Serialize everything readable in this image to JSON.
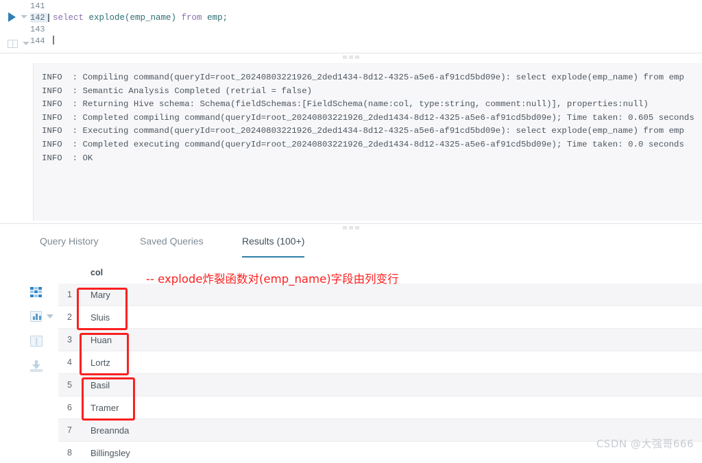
{
  "editor": {
    "gutter_icons": [
      "run-query-icon",
      "run-dropdown-icon",
      "explain-icon",
      "explain-dropdown-icon"
    ],
    "lines": [
      {
        "number": "141",
        "text": "",
        "active": false
      },
      {
        "number": "142",
        "active": true,
        "tokens": [
          {
            "t": "select ",
            "k": "kw"
          },
          {
            "t": "explode(emp_name) ",
            "k": "id"
          },
          {
            "t": "from ",
            "k": "kw"
          },
          {
            "t": "emp;",
            "k": "id"
          }
        ]
      },
      {
        "number": "143",
        "text": "",
        "active": false
      },
      {
        "number": "144",
        "text": "",
        "active": false,
        "cursor": true
      }
    ]
  },
  "log": {
    "lines": [
      "INFO  : Compiling command(queryId=root_20240803221926_2ded1434-8d12-4325-a5e6-af91cd5bd09e): select explode(emp_name) from emp",
      "INFO  : Semantic Analysis Completed (retrial = false)",
      "INFO  : Returning Hive schema: Schema(fieldSchemas:[FieldSchema(name:col, type:string, comment:null)], properties:null)",
      "INFO  : Completed compiling command(queryId=root_20240803221926_2ded1434-8d12-4325-a5e6-af91cd5bd09e); Time taken: 0.605 seconds",
      "INFO  : Executing command(queryId=root_20240803221926_2ded1434-8d12-4325-a5e6-af91cd5bd09e): select explode(emp_name) from emp",
      "INFO  : Completed executing command(queryId=root_20240803221926_2ded1434-8d12-4325-a5e6-af91cd5bd09e); Time taken: 0.0 seconds",
      "INFO  : OK"
    ]
  },
  "tabs": [
    {
      "label": "Query History",
      "active": false
    },
    {
      "label": "Saved Queries",
      "active": false
    },
    {
      "label": "Results (100+)",
      "active": true
    }
  ],
  "sidetools": [
    {
      "name": "grid-view-icon",
      "active": true
    },
    {
      "name": "chart-view-icon",
      "active": false
    },
    {
      "name": "columns-view-icon",
      "active": false
    },
    {
      "name": "download-icon",
      "active": false
    }
  ],
  "results": {
    "column_header": "col",
    "annotation": "-- explode炸裂函数对(emp_name)字段由列变行",
    "rows": [
      {
        "index": "1",
        "col": "Mary"
      },
      {
        "index": "2",
        "col": "Sluis"
      },
      {
        "index": "3",
        "col": "Huan"
      },
      {
        "index": "4",
        "col": "Lortz"
      },
      {
        "index": "5",
        "col": "Basil"
      },
      {
        "index": "6",
        "col": "Tramer"
      },
      {
        "index": "7",
        "col": "Breannda"
      },
      {
        "index": "8",
        "col": "Billingsley"
      }
    ],
    "highlight_boxes": [
      {
        "rows": [
          "1",
          "2"
        ]
      },
      {
        "rows": [
          "3",
          "4"
        ]
      },
      {
        "rows": [
          "5",
          "6"
        ]
      }
    ]
  },
  "watermark": "CSDN @大强哥666",
  "colors": {
    "accent": "#2e7fa8",
    "annotation_red": "#fb2020",
    "keyword": "#8a6fae",
    "identifier": "#2d6e73",
    "row_alt": "#f5f5f7",
    "log_bg": "#f7f7f9"
  }
}
